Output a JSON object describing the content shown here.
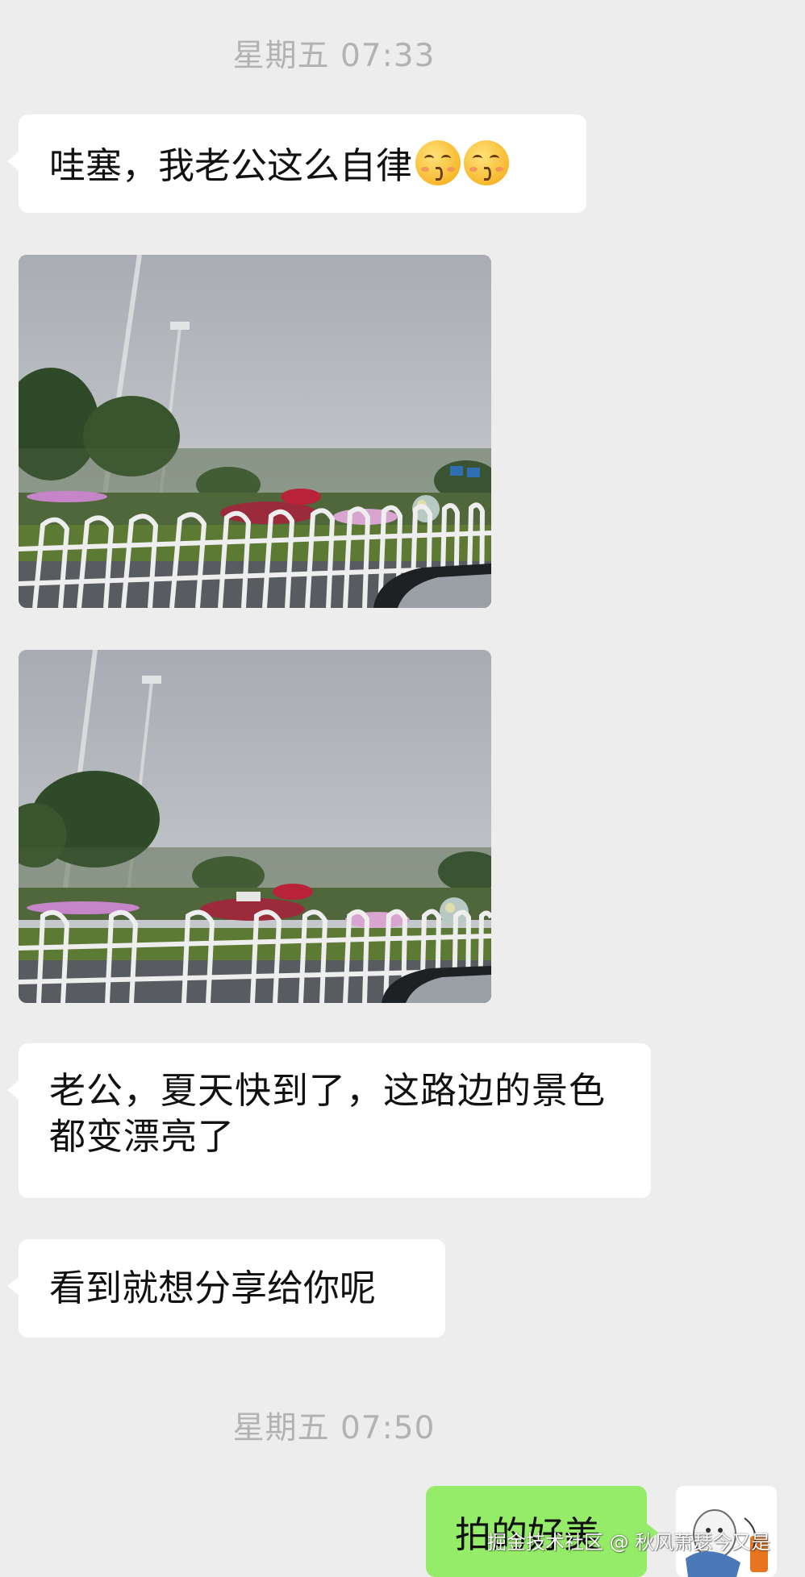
{
  "chat": {
    "timestamp_1": "星期五 07:33",
    "message_1": "哇塞，我老公这么自律",
    "message_1_emoji": [
      "kissing-face-emoji",
      "kissing-face-emoji"
    ],
    "photo_1": "roadside-flower-bed-photo",
    "photo_2": "roadside-flower-bed-photo",
    "message_2": "老公，夏天快到了，这路边的景色都变漂亮了",
    "message_3": "看到就想分享给你呢",
    "timestamp_2": "星期五 07:50",
    "reply_1": "拍的好美"
  },
  "watermark": "掘金技术社区 @ 秋风萧瑟今又是",
  "colors": {
    "background": "#ededed",
    "incoming_bubble": "#ffffff",
    "outgoing_bubble": "#95ec69",
    "timestamp": "#b2b2b2"
  }
}
